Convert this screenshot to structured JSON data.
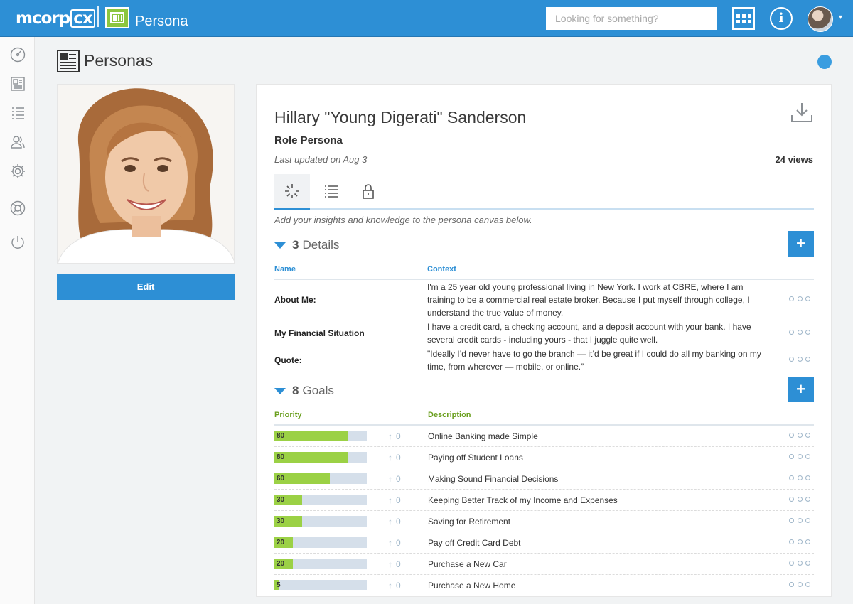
{
  "header": {
    "logo_text": "mcorp",
    "logo_badge": "cx",
    "app_name": "Persona",
    "search_placeholder": "Looking for something?",
    "info_icon_text": "i",
    "caret": "▾"
  },
  "page": {
    "title": "Personas"
  },
  "persona": {
    "edit_label": "Edit",
    "name": "Hillary \"Young Digerati\" Sanderson",
    "role": "Role Persona",
    "last_updated": "Last updated on Aug 3",
    "views": "24 views",
    "hint": "Add your insights and knowledge to the persona canvas below."
  },
  "details": {
    "count": "3",
    "label": "Details",
    "add_label": "+",
    "col_name": "Name",
    "col_context": "Context",
    "rows": [
      {
        "name": "About Me:",
        "context": "I'm a 25 year old young professional living in New York. I work at CBRE, where I am training to be a commercial real estate broker. Because I put myself through college, I understand the true value of money."
      },
      {
        "name": "My Financial Situation",
        "context": "I have a credit card, a checking account, and a deposit account with your bank. I have several credit cards - including yours - that I juggle quite well."
      },
      {
        "name": "Quote:",
        "context": "\"Ideally I’d never have to go the branch — it’d be great if I could do all my banking on my time, from wherever — mobile, or online.”"
      }
    ]
  },
  "goals": {
    "count": "8",
    "label": "Goals",
    "add_label": "+",
    "col_priority": "Priority",
    "col_description": "Description",
    "vote_arrow": "↑",
    "rows": [
      {
        "priority": 80,
        "priority_label": "80",
        "votes": "0",
        "description": "Online Banking made Simple"
      },
      {
        "priority": 80,
        "priority_label": "80",
        "votes": "0",
        "description": "Paying off Student Loans"
      },
      {
        "priority": 60,
        "priority_label": "60",
        "votes": "0",
        "description": "Making Sound Financial Decisions"
      },
      {
        "priority": 30,
        "priority_label": "30",
        "votes": "0",
        "description": "Keeping Better Track of my Income and Expenses"
      },
      {
        "priority": 30,
        "priority_label": "30",
        "votes": "0",
        "description": "Saving for Retirement"
      },
      {
        "priority": 20,
        "priority_label": "20",
        "votes": "0",
        "description": "Pay off Credit Card Debt"
      },
      {
        "priority": 20,
        "priority_label": "20",
        "votes": "0",
        "description": "Purchase a New Car"
      },
      {
        "priority": 5,
        "priority_label": "5",
        "votes": "0",
        "description": "Purchase a New Home"
      }
    ]
  },
  "colors": {
    "brand_blue": "#2d8fd5",
    "app_green": "#8cc63f",
    "priority_green": "#9bd145",
    "details_header": "#2d8fd5",
    "goals_header": "#6a9f1e"
  },
  "icons": {
    "sidebar": [
      "dashboard-icon",
      "persona-card-icon",
      "list-icon",
      "users-icon",
      "settings-icon",
      "help-icon",
      "power-icon"
    ],
    "tabs": [
      "insights-icon",
      "list-icon",
      "lock-icon"
    ]
  }
}
